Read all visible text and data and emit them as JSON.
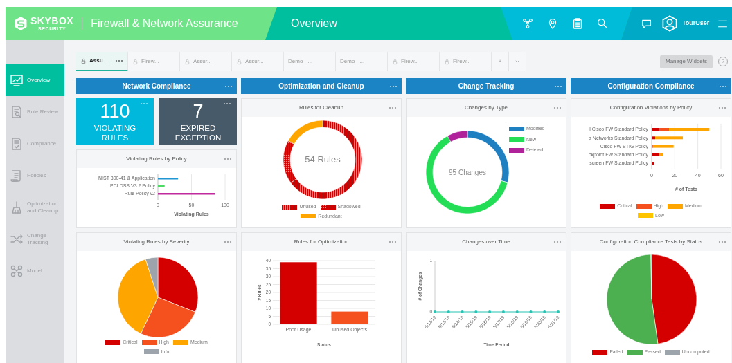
{
  "header": {
    "logo_name": "SKYBOX",
    "logo_tagline": "SECURITY",
    "app_title": "Firewall & Network Assurance",
    "page_title": "Overview",
    "user_name": "TourUser"
  },
  "sidebar": {
    "items": [
      {
        "label": "Overview",
        "kind": "overview",
        "selected": true
      },
      {
        "label": "Rule Review",
        "kind": "rule_review",
        "selected": false
      },
      {
        "label": "Compliance",
        "kind": "compliance",
        "selected": false
      },
      {
        "label": "Policies",
        "kind": "policies",
        "selected": false
      },
      {
        "label": "Optimization and Cleanup",
        "kind": "optimization",
        "selected": false
      },
      {
        "label": "Change Tracking",
        "kind": "change_tracking",
        "selected": false
      },
      {
        "label": "Model",
        "kind": "model",
        "selected": false
      }
    ]
  },
  "tabs": [
    {
      "label": "Assu...",
      "locked": true,
      "selected": true
    },
    {
      "label": "Firew...",
      "locked": true,
      "selected": false
    },
    {
      "label": "Assur...",
      "locked": true,
      "selected": false
    },
    {
      "label": "Assur...",
      "locked": true,
      "selected": false
    },
    {
      "label": "Demo - ...",
      "locked": false,
      "selected": false
    },
    {
      "label": "Demo - ...",
      "locked": false,
      "selected": false
    },
    {
      "label": "Firew...",
      "locked": true,
      "selected": false
    },
    {
      "label": "Firew...",
      "locked": true,
      "selected": false
    }
  ],
  "add_tab": "+",
  "manage_widgets": {
    "label": "Manage Widgets",
    "disabled": true
  },
  "help": "?",
  "columns": [
    {
      "heading": "Network Compliance",
      "widgets": [
        {
          "kind": "kpis",
          "tiles": [
            {
              "value": "110",
              "label": "VIOLATING RULES",
              "color": "#00b8dc"
            },
            {
              "value": "7",
              "label": "EXPIRED EXCEPTION",
              "color": "#465a69"
            }
          ]
        },
        {
          "kind": "hbar",
          "title": "Violating Rules by Policy",
          "chart_data": {
            "type": "bar",
            "orientation": "horizontal",
            "stacked": true,
            "grid": true,
            "categories": [
              "NIST 800-41 & Application",
              "PCI DSS V3.2 Policy",
              "Rule Policy v2"
            ],
            "xlabel": "Violating Rules",
            "xlim": [
              0,
              100
            ],
            "xticks": [
              0,
              50,
              100
            ],
            "series": [
              {
                "color": "#2196d3",
                "values": [
                  30,
                  null,
                  null
                ]
              },
              {
                "color": "#4cd964",
                "values": [
                  null,
                  10,
                  null
                ]
              },
              {
                "color": "#c02a9e",
                "values": [
                  null,
                  null,
                  85
                ]
              }
            ]
          }
        },
        {
          "kind": "pie",
          "title": "Violating Rules by Severity",
          "legend_beside": false,
          "legend": [
            {
              "label": "Critical",
              "color": "#d40000",
              "kind": "solid"
            },
            {
              "label": "High",
              "color": "#f4511e",
              "kind": "solid"
            },
            {
              "label": "Medium",
              "color": "#ffa500",
              "kind": "solid"
            },
            {
              "label": "Info",
              "color": "#9ea4ab",
              "kind": "solid"
            }
          ]
        }
      ]
    },
    {
      "heading": "Optimization and Cleanup",
      "widgets": [
        {
          "kind": "donut",
          "title": "Rules for Cleanup",
          "center_label": "54 Rules",
          "legend_beside": false,
          "legend": [
            {
              "label": "Unused",
              "color": "#d40000",
              "kind": "stripes"
            },
            {
              "label": "Shadowed",
              "color": "#d40000",
              "kind": "dots"
            },
            {
              "label": "Redundant",
              "color": "#ffa500",
              "kind": "solid"
            }
          ]
        },
        {
          "kind": "vbar",
          "title": "Rules for Optimization",
          "chart_data": {
            "type": "bar",
            "orientation": "vertical",
            "stacked": true,
            "grid": true,
            "categories": [
              "Poor Usage",
              "Unused Objects"
            ],
            "xlabel": "Status",
            "ylabel": "# Rules",
            "ylim": [
              0,
              40
            ],
            "yticks": [
              0,
              5,
              10,
              15,
              20,
              25,
              30,
              35,
              40
            ],
            "series": [
              {
                "color": "#d40000",
                "values": [
                  39,
                  null
                ]
              },
              {
                "color": "#f4511e",
                "values": [
                  null,
                  8
                ]
              }
            ]
          }
        }
      ]
    },
    {
      "heading": "Change Tracking",
      "widgets": [
        {
          "kind": "donut",
          "title": "Changes by Type",
          "center_label": "95 Changes",
          "legend_beside": true,
          "legend": [
            {
              "label": "Modified",
              "color": "#1e7fc1",
              "kind": "solid"
            },
            {
              "label": "New",
              "color": "#22dd55",
              "kind": "solid"
            },
            {
              "label": "Deleted",
              "color": "#b0229a",
              "kind": "solid"
            }
          ]
        },
        {
          "kind": "line",
          "title": "Changes over Time",
          "chart_data": {
            "type": "line",
            "x": [
              "5/12/19",
              "5/13/19",
              "5/14/19",
              "5/15/19",
              "5/16/19",
              "5/17/19",
              "5/18/19",
              "5/19/19",
              "5/20/19",
              "5/21/19"
            ],
            "xlabel": "Time Period",
            "ylabel": "# of Changes",
            "ylim": [
              0,
              1
            ],
            "yticks": [
              0,
              1
            ],
            "series": [
              {
                "color": "#27c4b4",
                "values": [
                  0,
                  0,
                  0,
                  0,
                  0,
                  0,
                  0,
                  0,
                  0,
                  0
                ]
              }
            ]
          }
        }
      ]
    },
    {
      "heading": "Configuration Compliance",
      "widgets": [
        {
          "kind": "stacked_hbar",
          "title": "Configuration Violations by Policy",
          "chart_data": {
            "type": "bar",
            "orientation": "horizontal",
            "stacked": true,
            "grid": true,
            "legend": "bottom",
            "categories": [
              "l Cisco FW Standard Policy",
              "a Networks Standard Policy",
              "Cisco FW STIG Policy",
              "ckpoint FW Standard Policy",
              "screen FW Standard Policy"
            ],
            "xlabel": "# of Tests",
            "xlim": [
              0,
              60
            ],
            "xticks": [
              0,
              20,
              40,
              60
            ],
            "series": [
              {
                "name": "Critical",
                "color": "#d40000",
                "values": [
                  7,
                  3,
                  1,
                  6,
                  2
                ]
              },
              {
                "name": "High",
                "color": "#f4511e",
                "values": [
                  8,
                  0,
                  0,
                  1,
                  0
                ]
              },
              {
                "name": "Medium",
                "color": "#ffa500",
                "values": [
                  35,
                  24,
                  18,
                  3,
                  0
                ]
              },
              {
                "name": "Low",
                "color": "#ffc400",
                "values": [
                  0,
                  0,
                  0,
                  0,
                  0
                ]
              }
            ]
          }
        },
        {
          "kind": "pie",
          "title": "Configuration Compliance Tests by Status",
          "legend_beside": false,
          "legend": [
            {
              "label": "Failed",
              "color": "#d40000",
              "kind": "solid"
            },
            {
              "label": "Passed",
              "color": "#4caf50",
              "kind": "solid"
            },
            {
              "label": "Uncomputed",
              "color": "#9ea4ab",
              "kind": "solid"
            }
          ]
        }
      ]
    }
  ]
}
